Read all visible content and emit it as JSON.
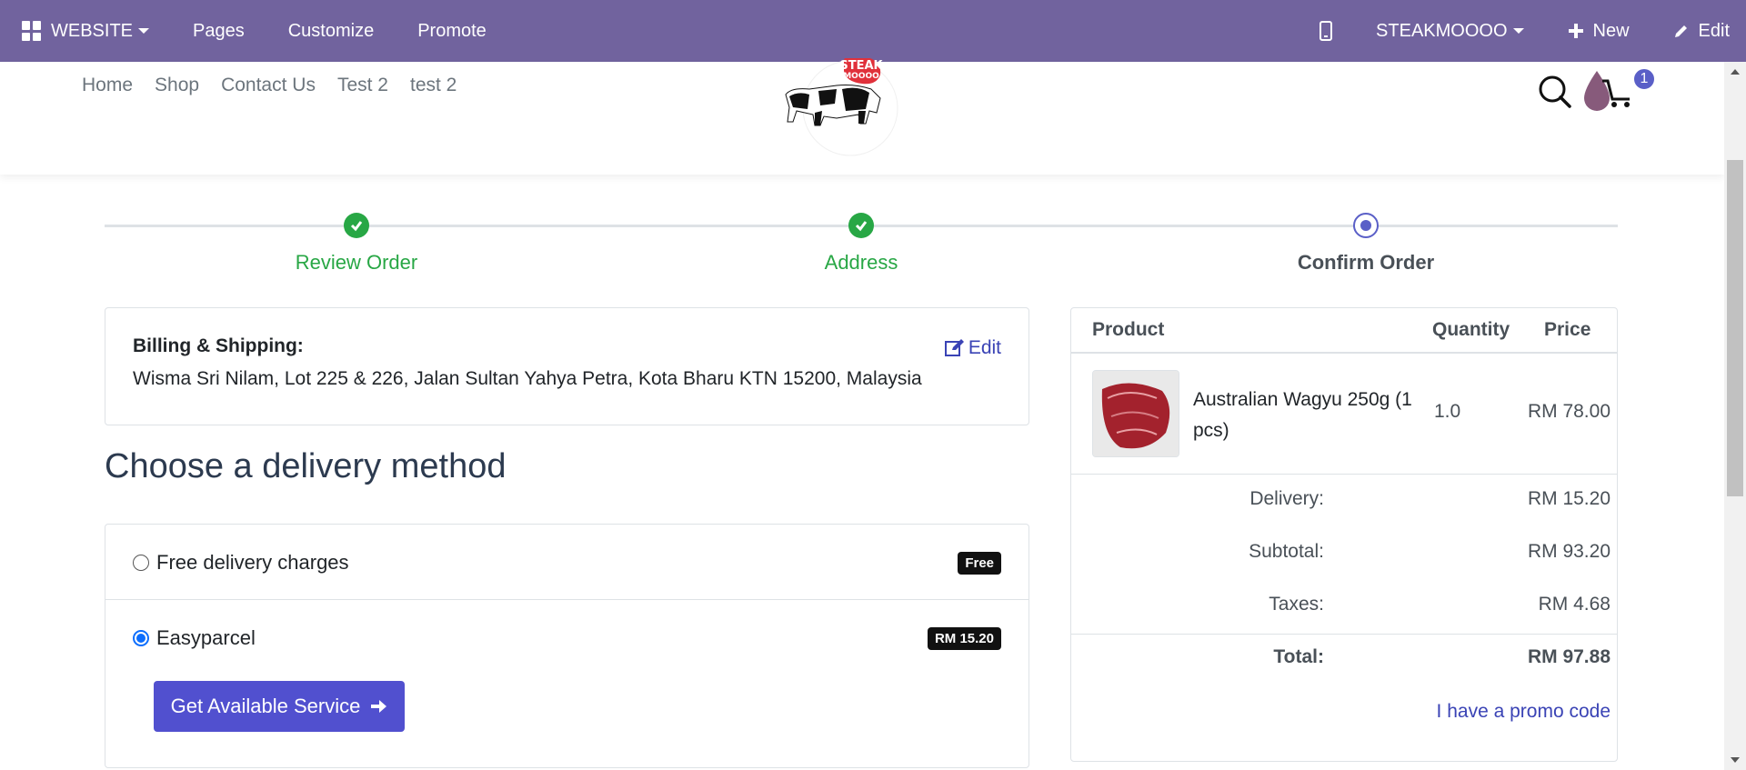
{
  "admin_bar": {
    "website_label": "WEBSITE",
    "pages_label": "Pages",
    "customize_label": "Customize",
    "promote_label": "Promote",
    "company_label": "STEAKMOOOO",
    "new_label": "New",
    "edit_label": "Edit"
  },
  "site_nav": {
    "items": [
      "Home",
      "Shop",
      "Contact Us",
      "Test 2",
      "test 2"
    ],
    "cart_count": "1",
    "logo_text_1": "STEAK",
    "logo_text_2": "MOOOO"
  },
  "steps": [
    {
      "label": "Review Order",
      "state": "done"
    },
    {
      "label": "Address",
      "state": "done"
    },
    {
      "label": "Confirm Order",
      "state": "current"
    }
  ],
  "billing": {
    "title": "Billing & Shipping:",
    "address": "Wisma Sri Nilam, Lot 225 & 226, Jalan Sultan Yahya Petra, Kota Bharu KTN 15200, Malaysia",
    "edit_label": "Edit"
  },
  "delivery": {
    "title": "Choose a delivery method",
    "options": [
      {
        "label": "Free delivery charges",
        "badge": "Free",
        "selected": false
      },
      {
        "label": "Easyparcel",
        "badge": "RM 15.20",
        "selected": true
      }
    ],
    "service_button": "Get Available Service"
  },
  "summary": {
    "headers": {
      "product": "Product",
      "quantity": "Quantity",
      "price": "Price"
    },
    "product": {
      "name": "Australian Wagyu 250g (1 pcs)",
      "quantity": "1.0",
      "price": "RM 78.00"
    },
    "delivery_label": "Delivery:",
    "delivery_value": "RM 15.20",
    "subtotal_label": "Subtotal:",
    "subtotal_value": "RM 93.20",
    "taxes_label": "Taxes:",
    "taxes_value": "RM 4.68",
    "total_label": "Total:",
    "total_value": "RM 97.88",
    "promo_label": "I have a promo code"
  },
  "colors": {
    "admin_bar": "#71639e",
    "success": "#28a745",
    "primary": "#5150cf",
    "link": "#3a43b5"
  }
}
